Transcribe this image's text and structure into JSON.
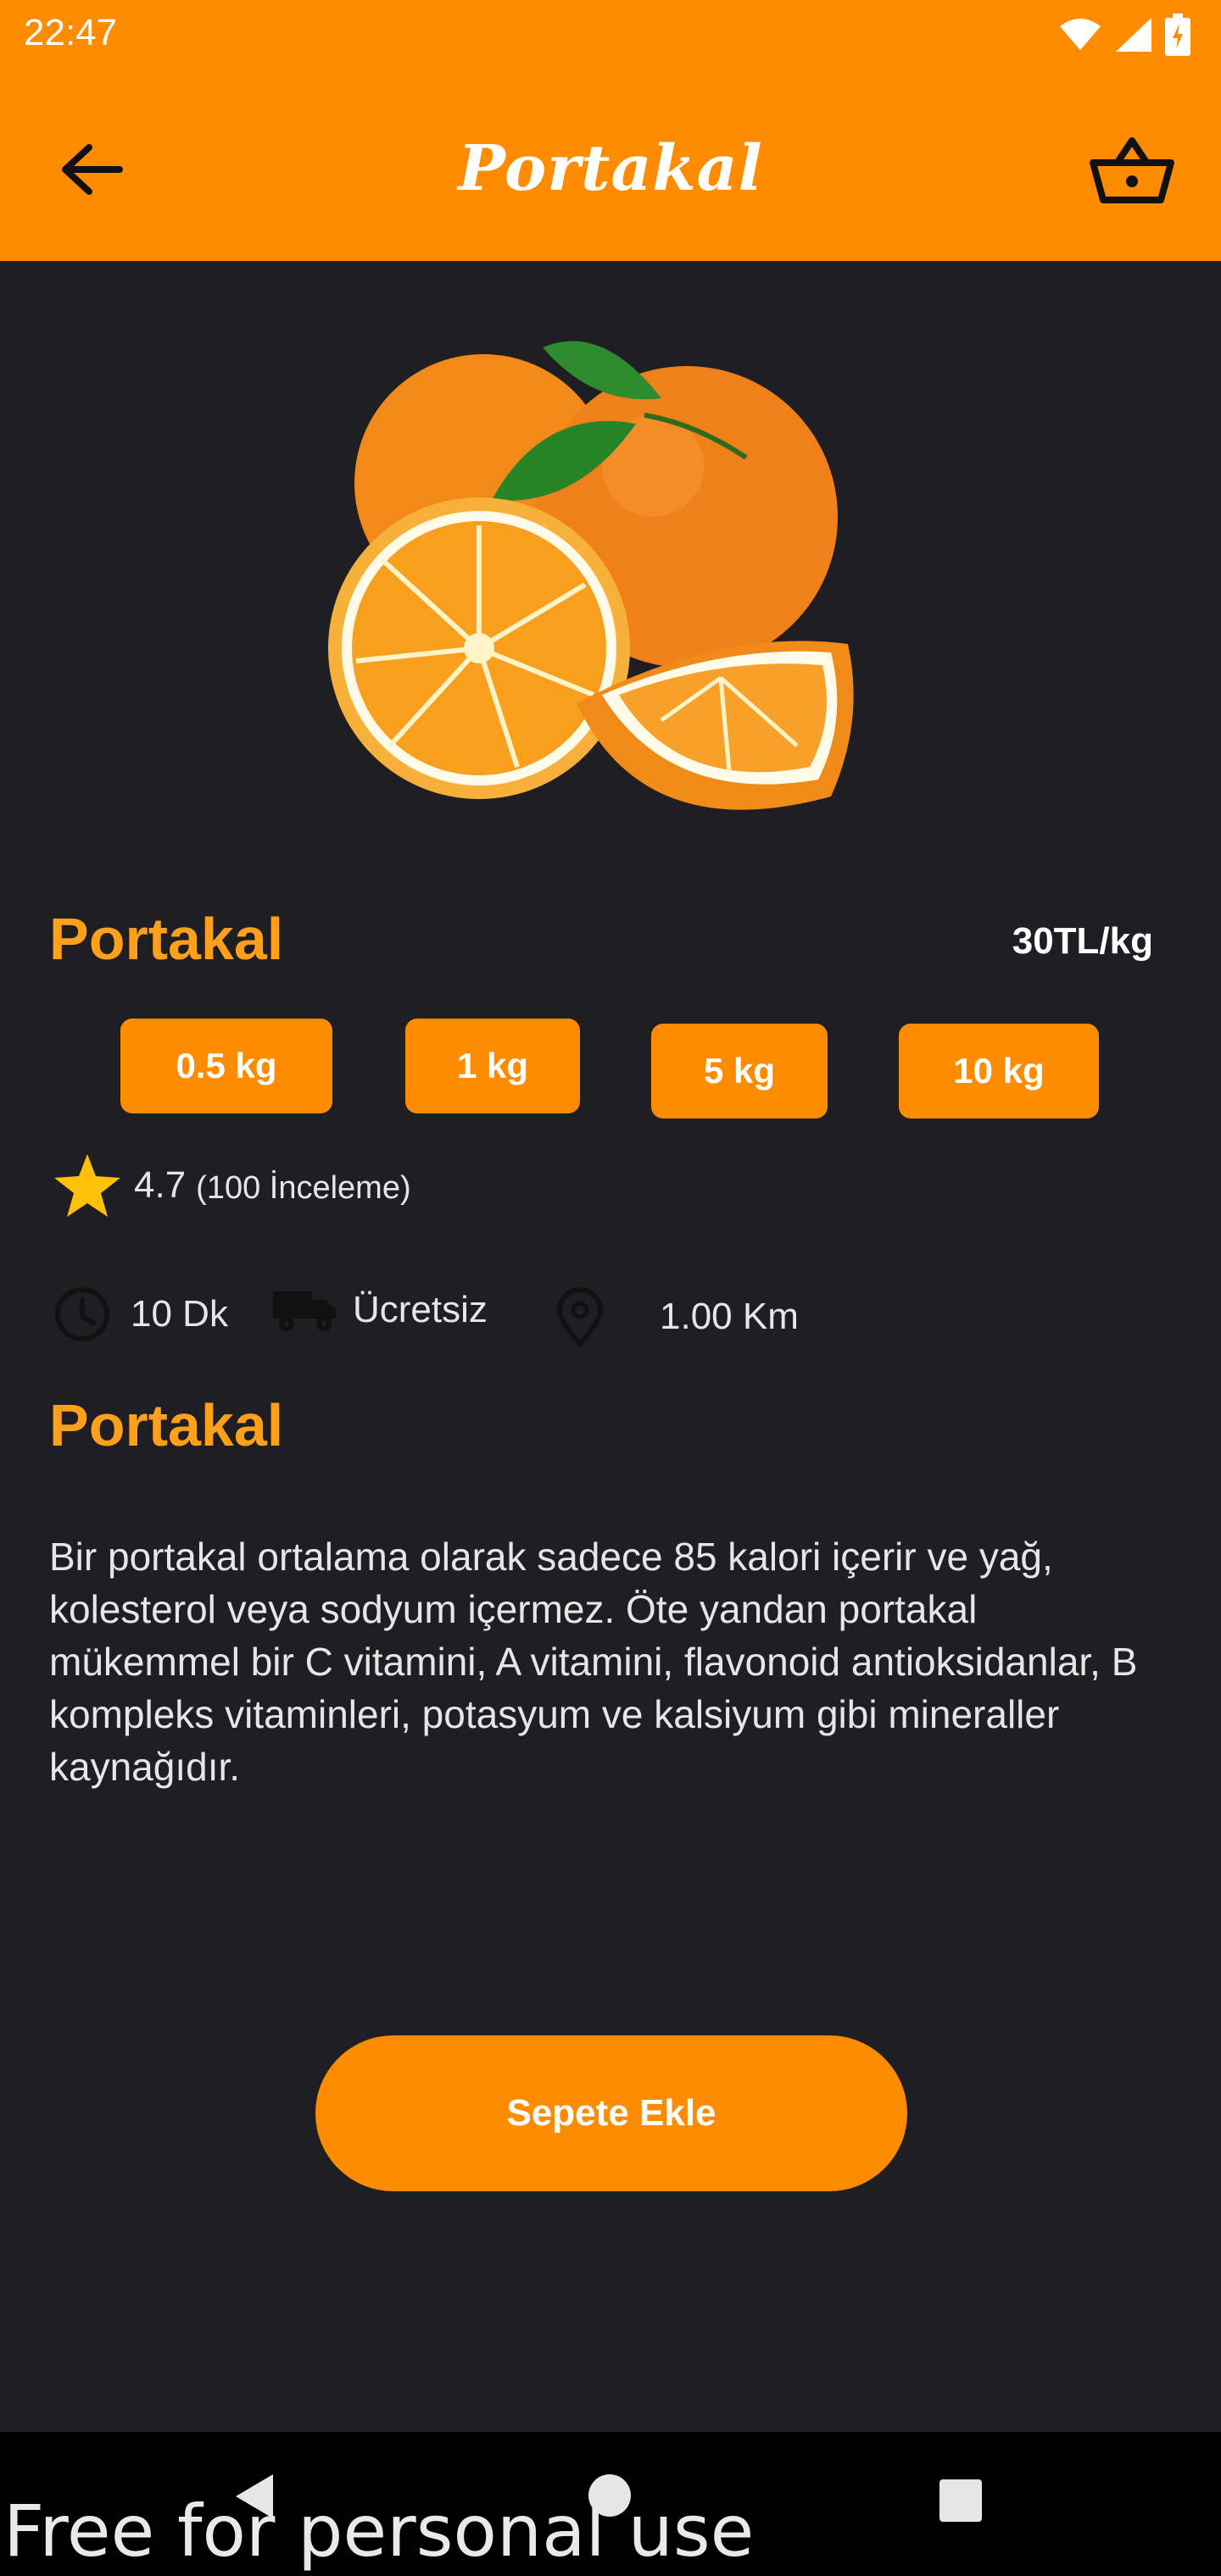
{
  "status_bar": {
    "time": "22:47"
  },
  "app_bar": {
    "title": "Portakal"
  },
  "product": {
    "name": "Portakal",
    "price": "30TL/kg",
    "weights": [
      "0.5 kg",
      "1 kg",
      "5 kg",
      "10 kg"
    ],
    "rating": {
      "value": "4.7",
      "count": "(100 İnceleme)"
    },
    "info": {
      "time": "10 Dk",
      "delivery": "Ücretsiz",
      "distance": "1.00 Km"
    },
    "description_title": "Portakal",
    "description": "Bir portakal ortalama olarak sadece 85 kalori içerir ve yağ, kolesterol veya sodyum içermez. Öte yandan portakal mükemmel bir C vitamini, A vitamini, flavonoid antioksidanlar, B kompleks vitaminleri, potasyum ve kalsiyum gibi mineraller kaynağıdır."
  },
  "actions": {
    "add_to_cart": "Sepete Ekle"
  },
  "watermark": "Free for personal use",
  "colors": {
    "accent": "#ff8c00",
    "title_accent": "#ffa01a",
    "background": "#1f1e22"
  },
  "icons": [
    "wifi-icon",
    "signal-icon",
    "battery-icon",
    "back-arrow-icon",
    "basket-icon",
    "star-icon",
    "clock-icon",
    "truck-icon",
    "location-pin-icon"
  ]
}
